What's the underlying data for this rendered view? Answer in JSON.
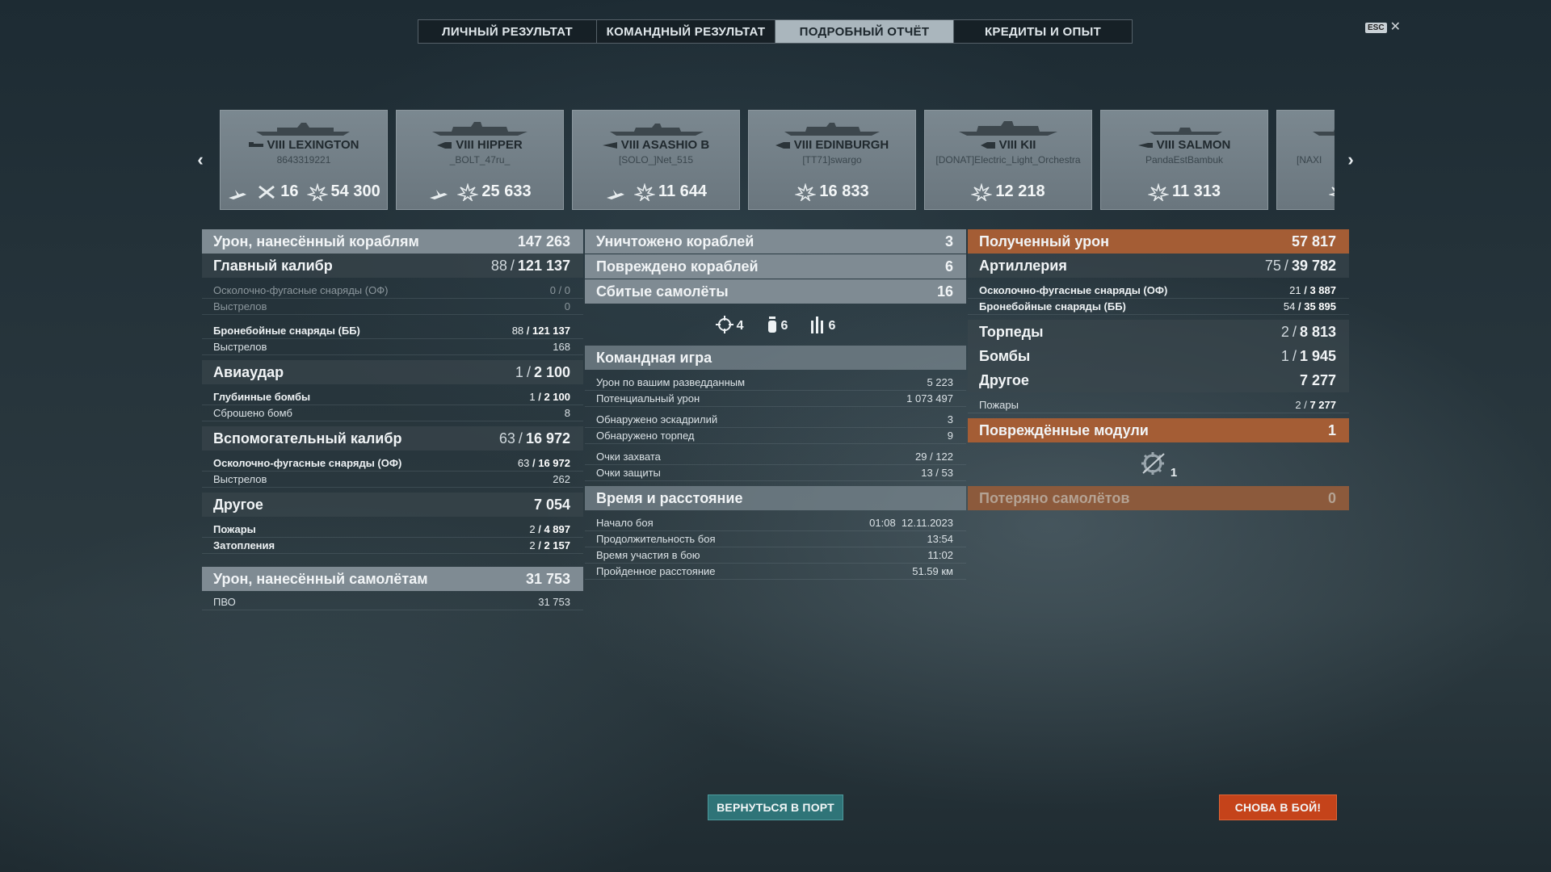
{
  "tabs": [
    {
      "label": "ЛИЧНЫЙ РЕЗУЛЬТАТ",
      "active": false
    },
    {
      "label": "КОМАНДНЫЙ РЕЗУЛЬТАТ",
      "active": false
    },
    {
      "label": "ПОДРОБНЫЙ ОТЧЁТ",
      "active": true
    },
    {
      "label": "КРЕДИТЫ И ОПЫТ",
      "active": false
    }
  ],
  "close": {
    "key": "ESC",
    "icon": "close-icon"
  },
  "ships": [
    {
      "name": "VIII LEXINGTON",
      "player": "8643319221",
      "planes": "16",
      "damage": "54 300",
      "class_icon": "aircraft-carrier-icon"
    },
    {
      "name": "VIII HIPPER",
      "player": "_BOLT_47ru_",
      "damage": "25 633",
      "class_icon": "cruiser-icon"
    },
    {
      "name": "VIII ASASHIO B",
      "player": "[SOLO_]Net_515",
      "damage": "11 644",
      "class_icon": "destroyer-icon"
    },
    {
      "name": "VIII EDINBURGH",
      "player": "[TT71]swargo",
      "damage": "16 833",
      "class_icon": "cruiser-icon"
    },
    {
      "name": "VIII KII",
      "player": "[DONAT]Electric_Light_Orchestra",
      "damage": "12 218",
      "class_icon": "battleship-icon"
    },
    {
      "name": "VIII SALMON",
      "player": "PandaEstBambuk",
      "damage": "11 313",
      "class_icon": "submarine-icon"
    },
    {
      "name": "",
      "player": "[NAXI",
      "damage": ""
    }
  ],
  "left": {
    "ship_damage": {
      "label": "Урон, нанесённый кораблям",
      "value": "147 263"
    },
    "main_battery": {
      "label": "Главный калибр",
      "hits": "88",
      "value": "121 137"
    },
    "he_main": {
      "label": "Осколочно-фугасные снаряды (ОФ)",
      "hits": "0",
      "value": "0"
    },
    "he_main_shots": {
      "label": "Выстрелов",
      "value": "0"
    },
    "ap_main": {
      "label": "Бронебойные снаряды (ББ)",
      "hits": "88",
      "value": "121 137"
    },
    "ap_main_shots": {
      "label": "Выстрелов",
      "value": "168"
    },
    "airstrike": {
      "label": "Авиаудар",
      "hits": "1",
      "value": "2 100"
    },
    "depth_charges": {
      "label": "Глубинные бомбы",
      "hits": "1",
      "value": "2 100"
    },
    "bombs_dropped": {
      "label": "Сброшено бомб",
      "value": "8"
    },
    "secondary": {
      "label": "Вспомогательный калибр",
      "hits": "63",
      "value": "16 972"
    },
    "he_secondary": {
      "label": "Осколочно-фугасные снаряды (ОФ)",
      "hits": "63",
      "value": "16 972"
    },
    "he_secondary_shots": {
      "label": "Выстрелов",
      "value": "262"
    },
    "other": {
      "label": "Другое",
      "value": "7 054"
    },
    "fires": {
      "label": "Пожары",
      "hits": "2",
      "value": "4 897"
    },
    "floods": {
      "label": "Затопления",
      "hits": "2",
      "value": "2 157"
    },
    "plane_damage": {
      "label": "Урон, нанесённый самолётам",
      "value": "31 753"
    },
    "aa": {
      "label": "ПВО",
      "value": "31 753"
    }
  },
  "middle": {
    "destroyed": {
      "label": "Уничтожено кораблей",
      "value": "3"
    },
    "damaged": {
      "label": "Повреждено кораблей",
      "value": "6"
    },
    "planes_shot": {
      "label": "Сбитые самолёты",
      "value": "16"
    },
    "icons": [
      {
        "icon": "crosshair-icon",
        "value": "4"
      },
      {
        "icon": "bomb-icon",
        "value": "6"
      },
      {
        "icon": "torpedo-icon",
        "value": "6"
      }
    ],
    "team_play": {
      "label": "Командная игра",
      "spotting_damage": {
        "label": "Урон по вашим разведданным",
        "value": "5 223"
      },
      "potential_damage": {
        "label": "Потенциальный урон",
        "value": "1 073 497"
      },
      "squadrons_spotted": {
        "label": "Обнаружено эскадрилий",
        "value": "3"
      },
      "torpedoes_spotted": {
        "label": "Обнаружено торпед",
        "value": "9"
      },
      "capture_points": {
        "label": "Очки захвата",
        "value": "29 / 122"
      },
      "defense_points": {
        "label": "Очки защиты",
        "value": "13 / 53"
      }
    },
    "time": {
      "label": "Время и расстояние",
      "start": {
        "label": "Начало боя",
        "value": "01:08  12.11.2023"
      },
      "duration": {
        "label": "Продолжительность боя",
        "value": "13:54"
      },
      "participation": {
        "label": "Время участия в бою",
        "value": "11:02"
      },
      "distance": {
        "label": "Пройденное расстояние",
        "value": "51.59 км"
      }
    }
  },
  "right": {
    "received": {
      "label": "Полученный урон",
      "value": "57 817"
    },
    "artillery": {
      "label": "Артиллерия",
      "hits": "75",
      "value": "39 782"
    },
    "he": {
      "label": "Осколочно-фугасные снаряды (ОФ)",
      "hits": "21",
      "value": "3 887"
    },
    "ap": {
      "label": "Бронебойные снаряды (ББ)",
      "hits": "54",
      "value": "35 895"
    },
    "torpedoes": {
      "label": "Торпеды",
      "hits": "2",
      "value": "8 813"
    },
    "bombs": {
      "label": "Бомбы",
      "hits": "1",
      "value": "1 945"
    },
    "other": {
      "label": "Другое",
      "value": "7 277"
    },
    "fires": {
      "label": "Пожары",
      "hits": "2",
      "value": "7 277"
    },
    "modules": {
      "label": "Повреждённые модули",
      "value": "1"
    },
    "module_icon": {
      "icon": "module-damage-icon",
      "value": "1"
    },
    "planes_lost": {
      "label": "Потеряно самолётов",
      "value": "0"
    }
  },
  "buttons": {
    "port": "ВЕРНУТЬСЯ В ПОРТ",
    "battle": "СНОВА В БОЙ!"
  },
  "colors": {
    "active_tab": "#aab6bd",
    "header_main": "#7f8b93",
    "header_orange": "#a45d35",
    "port_button": "#2f7478",
    "battle_button": "#c5431a"
  }
}
